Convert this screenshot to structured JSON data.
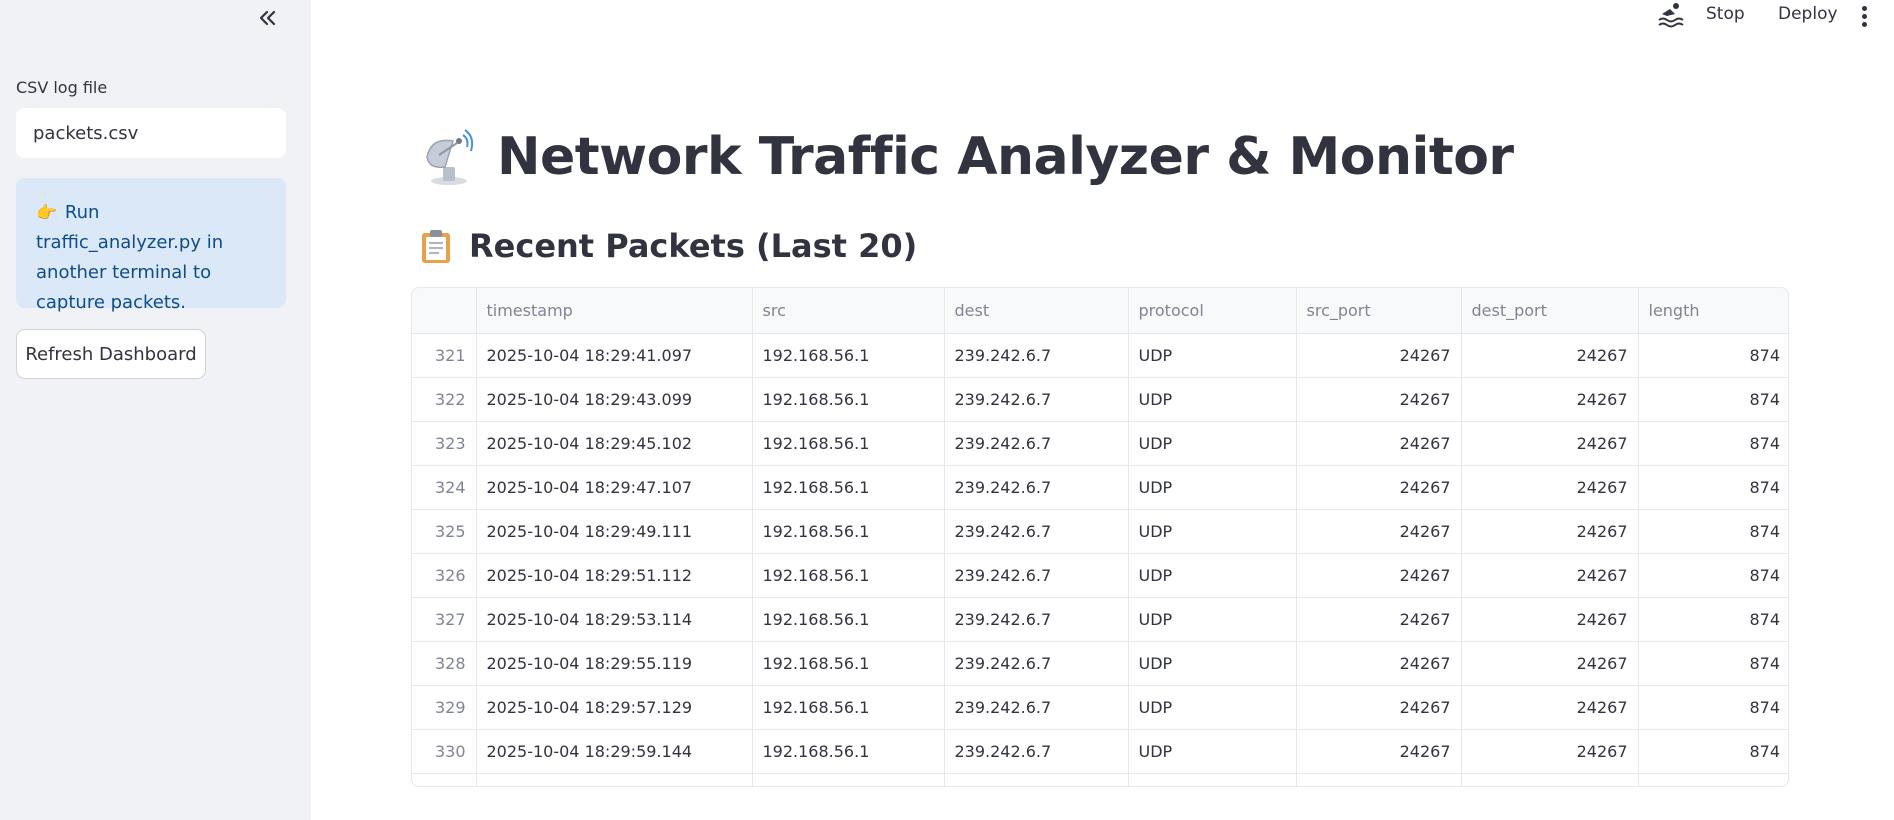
{
  "sidebar": {
    "collapse_icon": "double-chevron-left-icon",
    "csv_label": "CSV log file",
    "csv_value": "packets.csv",
    "info": {
      "emoji": "👉",
      "text": "Run traffic_analyzer.py in another terminal to capture packets."
    },
    "refresh_label": "Refresh Dashboard"
  },
  "toolbar": {
    "running_icon": "swimmer-running-icon",
    "stop_label": "Stop",
    "deploy_label": "Deploy",
    "menu_icon": "vertical-ellipsis-icon"
  },
  "main": {
    "title_icon": "satellite-dish-icon",
    "title": "Network Traffic Analyzer & Monitor",
    "subheader_icon": "clipboard-icon",
    "subheader": "Recent Packets (Last 20)"
  },
  "table": {
    "columns": [
      "",
      "timestamp",
      "src",
      "dest",
      "protocol",
      "src_port",
      "dest_port",
      "length"
    ],
    "rows": [
      {
        "idx": "321",
        "timestamp": "2025-10-04 18:29:41.097",
        "src": "192.168.56.1",
        "dest": "239.242.6.7",
        "protocol": "UDP",
        "src_port": "24267",
        "dest_port": "24267",
        "length": "874"
      },
      {
        "idx": "322",
        "timestamp": "2025-10-04 18:29:43.099",
        "src": "192.168.56.1",
        "dest": "239.242.6.7",
        "protocol": "UDP",
        "src_port": "24267",
        "dest_port": "24267",
        "length": "874"
      },
      {
        "idx": "323",
        "timestamp": "2025-10-04 18:29:45.102",
        "src": "192.168.56.1",
        "dest": "239.242.6.7",
        "protocol": "UDP",
        "src_port": "24267",
        "dest_port": "24267",
        "length": "874"
      },
      {
        "idx": "324",
        "timestamp": "2025-10-04 18:29:47.107",
        "src": "192.168.56.1",
        "dest": "239.242.6.7",
        "protocol": "UDP",
        "src_port": "24267",
        "dest_port": "24267",
        "length": "874"
      },
      {
        "idx": "325",
        "timestamp": "2025-10-04 18:29:49.111",
        "src": "192.168.56.1",
        "dest": "239.242.6.7",
        "protocol": "UDP",
        "src_port": "24267",
        "dest_port": "24267",
        "length": "874"
      },
      {
        "idx": "326",
        "timestamp": "2025-10-04 18:29:51.112",
        "src": "192.168.56.1",
        "dest": "239.242.6.7",
        "protocol": "UDP",
        "src_port": "24267",
        "dest_port": "24267",
        "length": "874"
      },
      {
        "idx": "327",
        "timestamp": "2025-10-04 18:29:53.114",
        "src": "192.168.56.1",
        "dest": "239.242.6.7",
        "protocol": "UDP",
        "src_port": "24267",
        "dest_port": "24267",
        "length": "874"
      },
      {
        "idx": "328",
        "timestamp": "2025-10-04 18:29:55.119",
        "src": "192.168.56.1",
        "dest": "239.242.6.7",
        "protocol": "UDP",
        "src_port": "24267",
        "dest_port": "24267",
        "length": "874"
      },
      {
        "idx": "329",
        "timestamp": "2025-10-04 18:29:57.129",
        "src": "192.168.56.1",
        "dest": "239.242.6.7",
        "protocol": "UDP",
        "src_port": "24267",
        "dest_port": "24267",
        "length": "874"
      },
      {
        "idx": "330",
        "timestamp": "2025-10-04 18:29:59.144",
        "src": "192.168.56.1",
        "dest": "239.242.6.7",
        "protocol": "UDP",
        "src_port": "24267",
        "dest_port": "24267",
        "length": "874"
      },
      {
        "idx": "",
        "timestamp": "",
        "src": "",
        "dest": "",
        "protocol": "",
        "src_port": "",
        "dest_port": "",
        "length": ""
      }
    ]
  },
  "colors": {
    "sidebar_bg": "#f0f2f6",
    "info_bg": "#dbe8f7",
    "info_text": "#0f4c8a",
    "text": "#31333f",
    "muted": "#808495"
  }
}
